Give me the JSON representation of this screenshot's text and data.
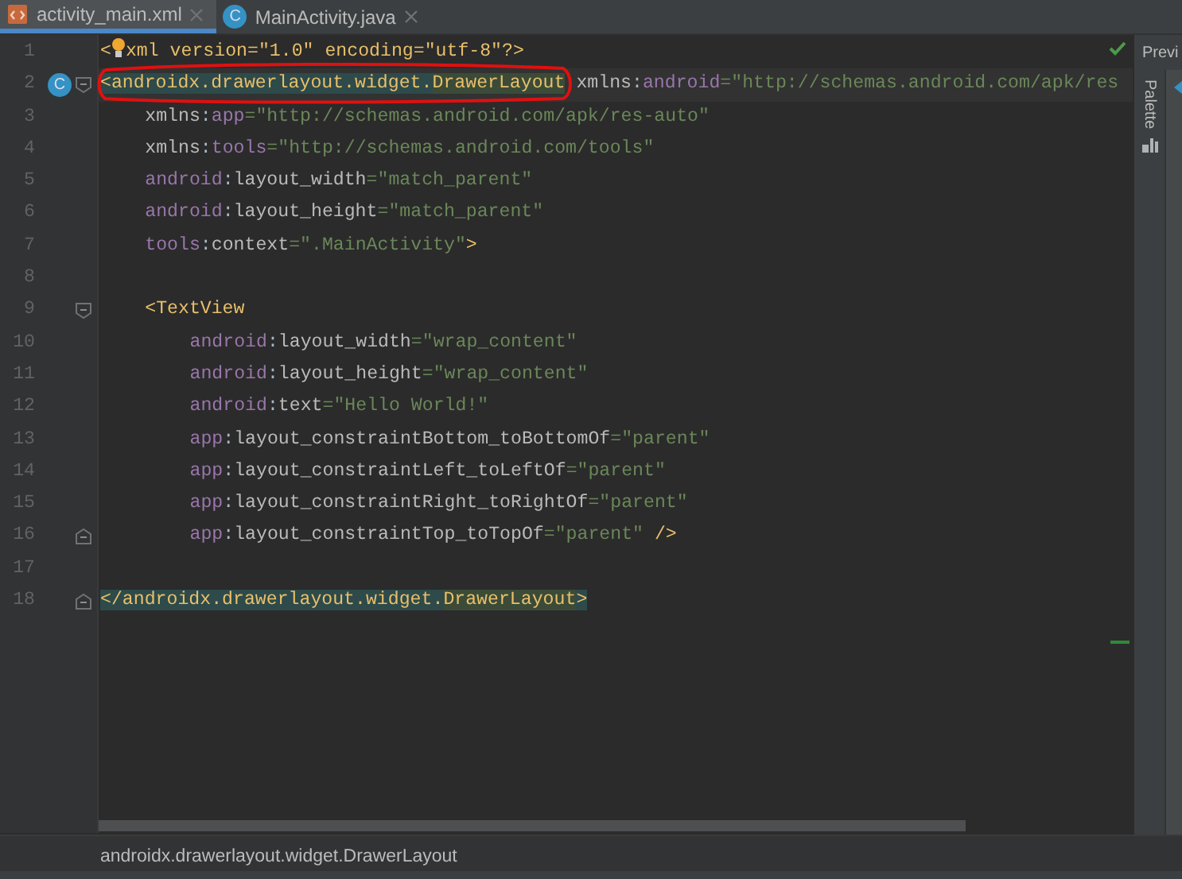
{
  "tabs": [
    {
      "label": "activity_main.xml",
      "kind": "xml",
      "selected": true
    },
    {
      "label": "MainActivity.java",
      "kind": "java",
      "badge": "C",
      "selected": false
    }
  ],
  "editor": {
    "lines": [
      {
        "number": "1",
        "kind": "root",
        "tokens": [
          {
            "kind": "tag",
            "text": "<"
          },
          {
            "kind": "bulb"
          },
          {
            "kind": "tag",
            "text": "xml version=\"1.0\" encoding=\"utf-8\"?>"
          }
        ]
      },
      {
        "number": "2",
        "kind": "root",
        "badge": "C",
        "fold_start": true,
        "current": true,
        "tokens": [
          {
            "kind": "tag",
            "text": "<androidx.drawerlayout.widget.",
            "highlighted": true
          },
          {
            "kind": "tag",
            "text": "DrawerLayout",
            "highlighted": true,
            "matched": true
          },
          {
            "kind": "attr",
            "text": " xmlns"
          },
          {
            "kind": "plain",
            "text": ":"
          },
          {
            "kind": "ns",
            "text": "android"
          },
          {
            "kind": "value",
            "text": "=\"http://schemas.android.com/apk/res"
          }
        ]
      },
      {
        "number": "3",
        "kind": "attribute",
        "tokens": [
          {
            "kind": "attr",
            "text": "xmlns"
          },
          {
            "kind": "plain",
            "text": ":"
          },
          {
            "kind": "ns",
            "text": "app"
          },
          {
            "kind": "value",
            "text": "=\"http://schemas.android.com/apk/res-auto\""
          }
        ]
      },
      {
        "number": "4",
        "kind": "attribute",
        "tokens": [
          {
            "kind": "attr",
            "text": "xmlns"
          },
          {
            "kind": "plain",
            "text": ":"
          },
          {
            "kind": "ns",
            "text": "tools"
          },
          {
            "kind": "value",
            "text": "=\"http://schemas.android.com/tools\""
          }
        ]
      },
      {
        "number": "5",
        "kind": "attribute",
        "tokens": [
          {
            "kind": "ns",
            "text": "android"
          },
          {
            "kind": "plain",
            "text": ":"
          },
          {
            "kind": "attr",
            "text": "layout_width"
          },
          {
            "kind": "value",
            "text": "=\"match_parent\""
          }
        ]
      },
      {
        "number": "6",
        "kind": "attribute",
        "tokens": [
          {
            "kind": "ns",
            "text": "android"
          },
          {
            "kind": "plain",
            "text": ":"
          },
          {
            "kind": "attr",
            "text": "layout_height"
          },
          {
            "kind": "value",
            "text": "=\"match_parent\""
          }
        ]
      },
      {
        "number": "7",
        "kind": "attribute",
        "tokens": [
          {
            "kind": "ns",
            "text": "tools"
          },
          {
            "kind": "plain",
            "text": ":"
          },
          {
            "kind": "attr",
            "text": "context"
          },
          {
            "kind": "value",
            "text": "=\".MainActivity\""
          },
          {
            "kind": "tag",
            "text": ">"
          }
        ]
      },
      {
        "number": "8",
        "kind": "blank"
      },
      {
        "number": "9",
        "kind": "child",
        "fold_start": true,
        "tokens": [
          {
            "kind": "tag",
            "text": "<TextView"
          }
        ]
      },
      {
        "number": "10",
        "kind": "child_attribute",
        "tokens": [
          {
            "kind": "ns",
            "text": "android"
          },
          {
            "kind": "plain",
            "text": ":"
          },
          {
            "kind": "attr",
            "text": "layout_width"
          },
          {
            "kind": "value",
            "text": "=\"wrap_content\""
          }
        ]
      },
      {
        "number": "11",
        "kind": "child_attribute",
        "tokens": [
          {
            "kind": "ns",
            "text": "android"
          },
          {
            "kind": "plain",
            "text": ":"
          },
          {
            "kind": "attr",
            "text": "layout_height"
          },
          {
            "kind": "value",
            "text": "=\"wrap_content\""
          }
        ]
      },
      {
        "number": "12",
        "kind": "child_attribute",
        "tokens": [
          {
            "kind": "ns",
            "text": "android"
          },
          {
            "kind": "plain",
            "text": ":"
          },
          {
            "kind": "attr",
            "text": "text"
          },
          {
            "kind": "value",
            "text": "=\"Hello World!\""
          }
        ]
      },
      {
        "number": "13",
        "kind": "child_attribute",
        "tokens": [
          {
            "kind": "ns",
            "text": "app"
          },
          {
            "kind": "plain",
            "text": ":"
          },
          {
            "kind": "attr",
            "text": "layout_constraintBottom_toBottomOf"
          },
          {
            "kind": "value",
            "text": "=\"parent\""
          }
        ]
      },
      {
        "number": "14",
        "kind": "child_attribute",
        "tokens": [
          {
            "kind": "ns",
            "text": "app"
          },
          {
            "kind": "plain",
            "text": ":"
          },
          {
            "kind": "attr",
            "text": "layout_constraintLeft_toLeftOf"
          },
          {
            "kind": "value",
            "text": "=\"parent\""
          }
        ]
      },
      {
        "number": "15",
        "kind": "child_attribute",
        "tokens": [
          {
            "kind": "ns",
            "text": "app"
          },
          {
            "kind": "plain",
            "text": ":"
          },
          {
            "kind": "attr",
            "text": "layout_constraintRight_toRightOf"
          },
          {
            "kind": "value",
            "text": "=\"parent\""
          }
        ]
      },
      {
        "number": "16",
        "kind": "child_attribute",
        "fold_end": true,
        "tokens": [
          {
            "kind": "ns",
            "text": "app"
          },
          {
            "kind": "plain",
            "text": ":"
          },
          {
            "kind": "attr",
            "text": "layout_constraintTop_toTopOf"
          },
          {
            "kind": "value",
            "text": "=\"parent\""
          },
          {
            "kind": "tag",
            "text": " />"
          }
        ]
      },
      {
        "number": "17",
        "kind": "blank"
      },
      {
        "number": "18",
        "kind": "root",
        "fold_end": true,
        "tokens": [
          {
            "kind": "tag",
            "text": "</androidx.drawerlayout.widget.",
            "highlighted": true
          },
          {
            "kind": "tag",
            "text": "DrawerLayout",
            "highlighted": true,
            "matched": true
          },
          {
            "kind": "tag",
            "text": ">",
            "highlighted": true
          }
        ]
      }
    ]
  },
  "breadcrumb": "androidx.drawerlayout.widget.DrawerLayout",
  "side_panel": {
    "header": "Previ",
    "tool": "Palette"
  }
}
